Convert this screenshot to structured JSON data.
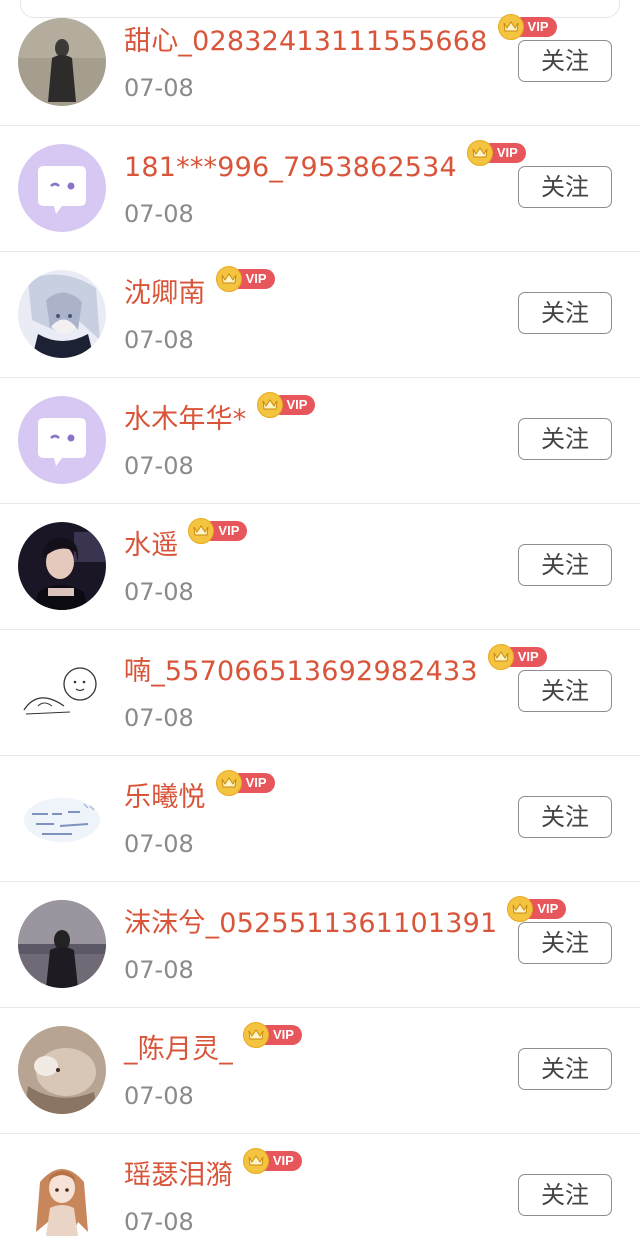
{
  "follow_label": "关注",
  "vip_label": "VIP",
  "items": [
    {
      "name": "甜心_02832413111555668",
      "date": "07-08",
      "avatar": "photo-dark-figure"
    },
    {
      "name": "181***996_7953862534",
      "date": "07-08",
      "avatar": "default-chat-bubble"
    },
    {
      "name": "沈卿南",
      "date": "07-08",
      "avatar": "anime-white-hair"
    },
    {
      "name": "水木年华*",
      "date": "07-08",
      "avatar": "default-chat-bubble"
    },
    {
      "name": "水遥",
      "date": "07-08",
      "avatar": "photo-woman-dark"
    },
    {
      "name": "喃_557066513692982433",
      "date": "07-08",
      "avatar": "sketch-doodle"
    },
    {
      "name": "乐曦悦",
      "date": "07-08",
      "avatar": "handwriting-image"
    },
    {
      "name": "沫沫兮_0525511361101391",
      "date": "07-08",
      "avatar": "photo-dusk-figure"
    },
    {
      "name": "_陈月灵_",
      "date": "07-08",
      "avatar": "photo-cat"
    },
    {
      "name": "瑶瑟泪漪",
      "date": "07-08",
      "avatar": "anime-girl-brown-hair"
    }
  ],
  "colors": {
    "name": "#d8553a",
    "date": "#8a8a8a",
    "vip_tag": "#e7565a",
    "crown": "#f4c441"
  }
}
